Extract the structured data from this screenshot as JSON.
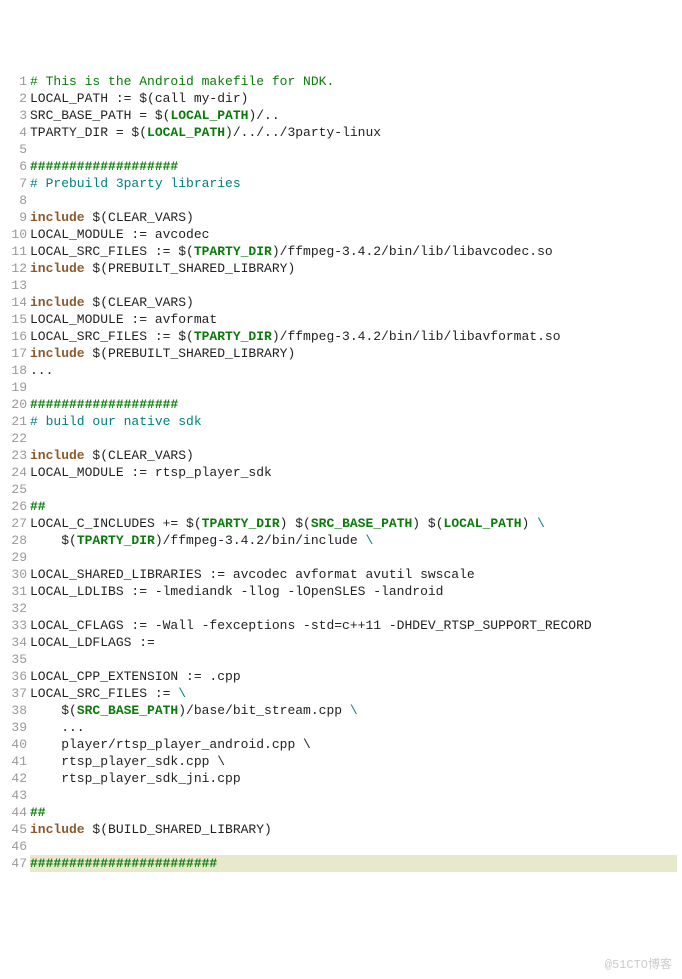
{
  "lines": [
    {
      "n": 1,
      "segs": [
        {
          "t": "# This is the Android makefile for NDK.",
          "c": "c-green"
        }
      ]
    },
    {
      "n": 2,
      "segs": [
        {
          "t": "LOCAL_PATH := $(call my-dir)"
        }
      ]
    },
    {
      "n": 3,
      "segs": [
        {
          "t": "SRC_BASE_PATH = $("
        },
        {
          "t": "LOCAL_PATH",
          "c": "c-var"
        },
        {
          "t": ")/.."
        }
      ]
    },
    {
      "n": 4,
      "segs": [
        {
          "t": "TPARTY_DIR = $("
        },
        {
          "t": "LOCAL_PATH",
          "c": "c-var"
        },
        {
          "t": ")/../../3party-linux"
        }
      ]
    },
    {
      "n": 5,
      "segs": [
        {
          "t": ""
        }
      ]
    },
    {
      "n": 6,
      "segs": [
        {
          "t": "###################",
          "c": "c-green-b"
        }
      ]
    },
    {
      "n": 7,
      "segs": [
        {
          "t": "# Prebuild 3party libraries",
          "c": "c-teal"
        }
      ]
    },
    {
      "n": 8,
      "segs": [
        {
          "t": ""
        }
      ]
    },
    {
      "n": 9,
      "segs": [
        {
          "t": "include",
          "c": "c-brown-b"
        },
        {
          "t": " $(CLEAR_VARS)"
        }
      ]
    },
    {
      "n": 10,
      "segs": [
        {
          "t": "LOCAL_MODULE := avcodec"
        }
      ]
    },
    {
      "n": 11,
      "segs": [
        {
          "t": "LOCAL_SRC_FILES := $("
        },
        {
          "t": "TPARTY_DIR",
          "c": "c-var"
        },
        {
          "t": ")/ffmpeg-3.4.2/bin/lib/libavcodec.so"
        }
      ]
    },
    {
      "n": 12,
      "segs": [
        {
          "t": "include",
          "c": "c-brown-b"
        },
        {
          "t": " $(PREBUILT_SHARED_LIBRARY)"
        }
      ]
    },
    {
      "n": 13,
      "segs": [
        {
          "t": ""
        }
      ]
    },
    {
      "n": 14,
      "segs": [
        {
          "t": "include",
          "c": "c-brown-b"
        },
        {
          "t": " $(CLEAR_VARS)"
        }
      ]
    },
    {
      "n": 15,
      "segs": [
        {
          "t": "LOCAL_MODULE := avformat"
        }
      ]
    },
    {
      "n": 16,
      "segs": [
        {
          "t": "LOCAL_SRC_FILES := $("
        },
        {
          "t": "TPARTY_DIR",
          "c": "c-var"
        },
        {
          "t": ")/ffmpeg-3.4.2/bin/lib/libavformat.so"
        }
      ]
    },
    {
      "n": 17,
      "segs": [
        {
          "t": "include",
          "c": "c-brown-b"
        },
        {
          "t": " $(PREBUILT_SHARED_LIBRARY)"
        }
      ]
    },
    {
      "n": 18,
      "segs": [
        {
          "t": "..."
        }
      ]
    },
    {
      "n": 19,
      "segs": [
        {
          "t": ""
        }
      ]
    },
    {
      "n": 20,
      "segs": [
        {
          "t": "###################",
          "c": "c-green-b"
        }
      ]
    },
    {
      "n": 21,
      "segs": [
        {
          "t": "# build our native sdk",
          "c": "c-teal"
        }
      ]
    },
    {
      "n": 22,
      "segs": [
        {
          "t": ""
        }
      ]
    },
    {
      "n": 23,
      "segs": [
        {
          "t": "include",
          "c": "c-brown-b"
        },
        {
          "t": " $(CLEAR_VARS)"
        }
      ]
    },
    {
      "n": 24,
      "segs": [
        {
          "t": "LOCAL_MODULE := rtsp_player_sdk"
        }
      ]
    },
    {
      "n": 25,
      "segs": [
        {
          "t": ""
        }
      ]
    },
    {
      "n": 26,
      "segs": [
        {
          "t": "##",
          "c": "c-green-b"
        }
      ]
    },
    {
      "n": 27,
      "segs": [
        {
          "t": "LOCAL_C_INCLUDES += $("
        },
        {
          "t": "TPARTY_DIR",
          "c": "c-var"
        },
        {
          "t": ") $("
        },
        {
          "t": "SRC_BASE_PATH",
          "c": "c-var"
        },
        {
          "t": ") $("
        },
        {
          "t": "LOCAL_PATH",
          "c": "c-var"
        },
        {
          "t": ") "
        },
        {
          "t": "\\",
          "c": "c-teal"
        }
      ]
    },
    {
      "n": 28,
      "segs": [
        {
          "t": "    $("
        },
        {
          "t": "TPARTY_DIR",
          "c": "c-var"
        },
        {
          "t": ")/ffmpeg-3.4.2/bin/include "
        },
        {
          "t": "\\",
          "c": "c-teal"
        }
      ]
    },
    {
      "n": 29,
      "segs": [
        {
          "t": ""
        }
      ]
    },
    {
      "n": 30,
      "segs": [
        {
          "t": "LOCAL_SHARED_LIBRARIES := avcodec avformat avutil swscale"
        }
      ]
    },
    {
      "n": 31,
      "segs": [
        {
          "t": "LOCAL_LDLIBS := -lmediandk -llog -lOpenSLES -landroid"
        }
      ]
    },
    {
      "n": 32,
      "segs": [
        {
          "t": ""
        }
      ]
    },
    {
      "n": 33,
      "segs": [
        {
          "t": "LOCAL_CFLAGS := -Wall -fexceptions -std=c++11 -DHDEV_RTSP_SUPPORT_RECORD"
        }
      ]
    },
    {
      "n": 34,
      "segs": [
        {
          "t": "LOCAL_LDFLAGS := "
        }
      ]
    },
    {
      "n": 35,
      "segs": [
        {
          "t": ""
        }
      ]
    },
    {
      "n": 36,
      "segs": [
        {
          "t": "LOCAL_CPP_EXTENSION := .cpp"
        }
      ]
    },
    {
      "n": 37,
      "segs": [
        {
          "t": "LOCAL_SRC_FILES := "
        },
        {
          "t": "\\",
          "c": "c-teal"
        }
      ]
    },
    {
      "n": 38,
      "segs": [
        {
          "t": "    $("
        },
        {
          "t": "SRC_BASE_PATH",
          "c": "c-var"
        },
        {
          "t": ")/base/bit_stream.cpp "
        },
        {
          "t": "\\",
          "c": "c-teal"
        }
      ]
    },
    {
      "n": 39,
      "segs": [
        {
          "t": "    ..."
        }
      ]
    },
    {
      "n": 40,
      "segs": [
        {
          "t": "    player/rtsp_player_android.cpp \\"
        }
      ]
    },
    {
      "n": 41,
      "segs": [
        {
          "t": "    rtsp_player_sdk.cpp \\"
        }
      ]
    },
    {
      "n": 42,
      "segs": [
        {
          "t": "    rtsp_player_sdk_jni.cpp"
        }
      ]
    },
    {
      "n": 43,
      "segs": [
        {
          "t": ""
        }
      ]
    },
    {
      "n": 44,
      "segs": [
        {
          "t": "##",
          "c": "c-green-b"
        }
      ]
    },
    {
      "n": 45,
      "segs": [
        {
          "t": "include",
          "c": "c-brown-b"
        },
        {
          "t": " $(BUILD_SHARED_LIBRARY)"
        }
      ]
    },
    {
      "n": 46,
      "segs": [
        {
          "t": ""
        }
      ]
    },
    {
      "n": 47,
      "segs": [
        {
          "t": "########################",
          "c": "c-green-b"
        }
      ],
      "hl": true
    }
  ],
  "watermark": "@51CTO博客"
}
